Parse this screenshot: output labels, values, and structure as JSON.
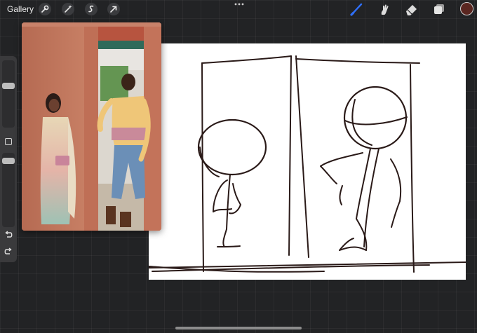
{
  "topbar": {
    "gallery_label": "Gallery",
    "left_tools": [
      "wrench-icon",
      "magic-wand-icon",
      "selection-icon",
      "transform-arrow-icon"
    ],
    "more_icon": "ellipsis-icon",
    "right_tools": [
      "brush-icon",
      "smudge-icon",
      "eraser-icon",
      "layers-icon"
    ],
    "active_color": "#5a2620",
    "accent_color": "#2f6ff7"
  },
  "sidebar": {
    "brush_size_level": 0.55,
    "opacity_level": 0.45,
    "modify_icon": "square-icon",
    "undo_icon": "undo-icon",
    "redo_icon": "redo-icon"
  },
  "reference": {
    "description_icon": "reference-photo"
  }
}
